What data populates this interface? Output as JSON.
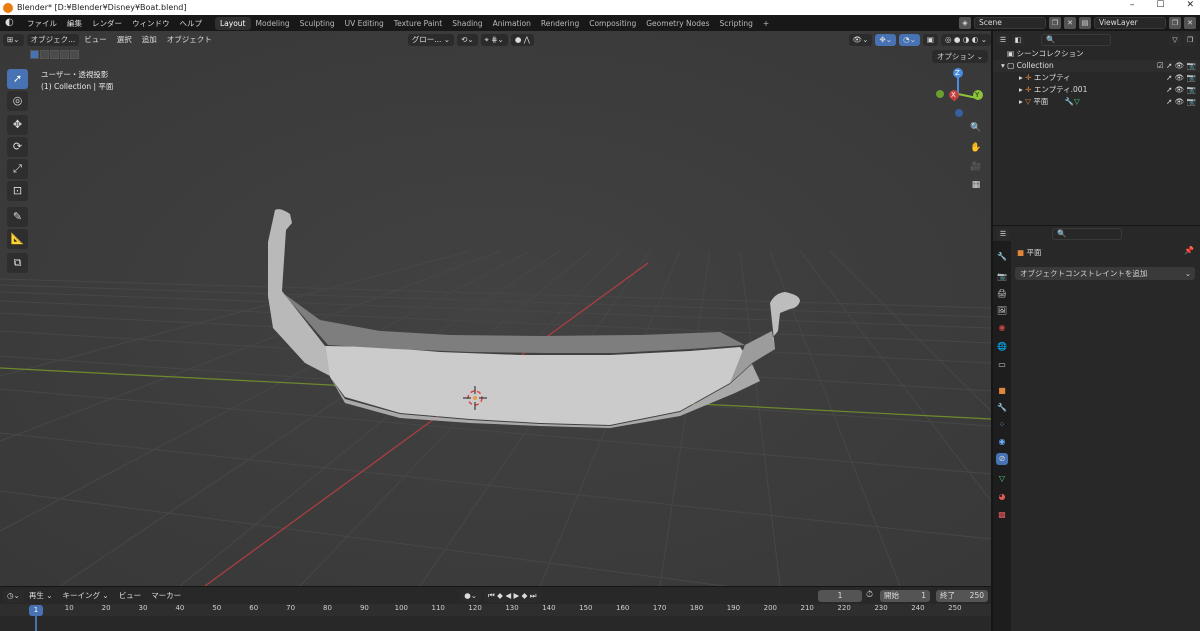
{
  "window": {
    "title": "Blender* [D:¥Blender¥Disney¥Boat.blend]",
    "min": "–",
    "max": "☐",
    "close": "✕"
  },
  "menubar": {
    "items": [
      "ファイル",
      "編集",
      "レンダー",
      "ウィンドウ",
      "ヘルプ"
    ],
    "workspaces": [
      "Layout",
      "Modeling",
      "Sculpting",
      "UV Editing",
      "Texture Paint",
      "Shading",
      "Animation",
      "Rendering",
      "Compositing",
      "Geometry Nodes",
      "Scripting"
    ],
    "add": "+",
    "scene": "Scene",
    "viewlayer": "ViewLayer"
  },
  "viewport": {
    "mode": "オブジェク...",
    "menus": [
      "ビュー",
      "選択",
      "追加",
      "オブジェクト"
    ],
    "transform": "グロー...",
    "view_label": "ユーザー・透視投影",
    "context_label": "(1) Collection | 平面",
    "options": "オプション ⌄",
    "gizmo": {
      "z": "Z",
      "x": "X",
      "y": "Y"
    }
  },
  "outliner": {
    "scene_collection": "シーンコレクション",
    "collection": "Collection",
    "items": [
      {
        "label": "エンプティ",
        "icon": "empty-icon"
      },
      {
        "label": "エンプティ.001",
        "icon": "empty-icon"
      },
      {
        "label": "平面",
        "icon": "mesh-icon"
      }
    ]
  },
  "properties": {
    "object_name": "平面",
    "add_constraint": "オブジェクトコンストレイントを追加"
  },
  "timeline": {
    "menus": [
      "再生 ⌄",
      "キーイング ⌄",
      "ビュー",
      "マーカー"
    ],
    "current_frame": "1",
    "start_label": "開始",
    "start": "1",
    "end_label": "終了",
    "end": "250",
    "ticks": [
      "1",
      "10",
      "20",
      "30",
      "40",
      "50",
      "60",
      "70",
      "80",
      "90",
      "100",
      "110",
      "120",
      "130",
      "140",
      "150",
      "160",
      "170",
      "180",
      "190",
      "200",
      "210",
      "220",
      "230",
      "240",
      "250"
    ]
  },
  "colors": {
    "accent": "#4772b3",
    "viewport_bg": "#3d3d3d",
    "x_axis": "#c34040",
    "y_axis": "#8cc43a",
    "z_axis": "#4a8be0"
  }
}
